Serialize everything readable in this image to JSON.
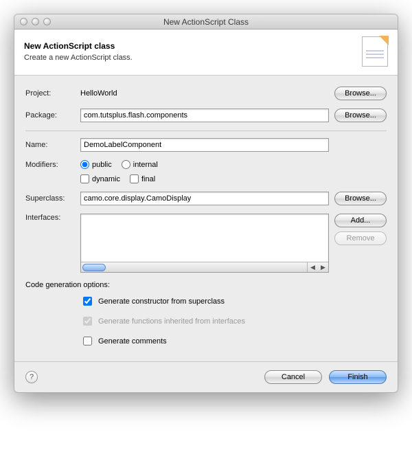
{
  "window": {
    "title": "New ActionScript Class"
  },
  "header": {
    "title": "New ActionScript class",
    "subtitle": "Create a new ActionScript class."
  },
  "labels": {
    "project": "Project:",
    "package": "Package:",
    "name": "Name:",
    "modifiers": "Modifiers:",
    "superclass": "Superclass:",
    "interfaces": "Interfaces:",
    "codegen": "Code generation options:"
  },
  "values": {
    "project": "HelloWorld",
    "package": "com.tutsplus.flash.components",
    "name": "DemoLabelComponent",
    "superclass": "camo.core.display.CamoDisplay"
  },
  "modifiers": {
    "public": "public",
    "internal": "internal",
    "dynamic": "dynamic",
    "final": "final",
    "selected": "public",
    "dynamic_checked": false,
    "final_checked": false
  },
  "codegen": {
    "constructor": "Generate constructor from superclass",
    "inherited": "Generate functions inherited from interfaces",
    "comments": "Generate comments",
    "constructor_checked": true,
    "inherited_checked": true,
    "comments_checked": false
  },
  "buttons": {
    "browse": "Browse...",
    "add": "Add...",
    "remove": "Remove",
    "cancel": "Cancel",
    "finish": "Finish",
    "help": "?"
  }
}
